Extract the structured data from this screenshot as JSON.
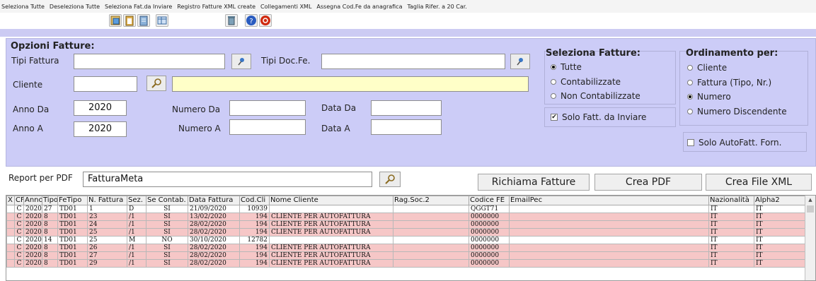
{
  "menu": [
    "Seleziona Tutte",
    "Deseleziona Tutte",
    "Seleziona Fat.da Inviare",
    "Registro Fatture XML create",
    "Collegamenti XML",
    "Assegna Cod.Fe da anagrafica",
    "Taglia Rifer. a 20 Car."
  ],
  "toolbar_icons": [
    "copy-icon",
    "clipboard-icon",
    "report-icon",
    "table-icon",
    "trash-icon",
    "help-icon",
    "stop-icon"
  ],
  "options": {
    "title": "Opzioni Fatture:",
    "tipi_fattura_label": "Tipi Fattura",
    "tipi_fattura_value": "",
    "tipi_docfe_label": "Tipi Doc.Fe.",
    "tipi_docfe_value": "",
    "cliente_label": "Cliente",
    "cliente_code": "",
    "cliente_name": "",
    "anno_da_label": "Anno Da",
    "anno_da_value": "2020",
    "anno_a_label": "Anno A",
    "anno_a_value": "2020",
    "numero_da_label": "Numero Da",
    "numero_da_value": "",
    "numero_a_label": "Numero A",
    "numero_a_value": "",
    "data_da_label": "Data Da",
    "data_da_value": "",
    "data_a_label": "Data A",
    "data_a_value": ""
  },
  "seleziona": {
    "title": "Seleziona Fatture:",
    "options": [
      "Tutte",
      "Contabilizzate",
      "Non Contabilizzate"
    ],
    "selected": 0,
    "solo_inviare": "Solo Fatt. da Inviare",
    "solo_inviare_checked": true
  },
  "ordinamento": {
    "title": "Ordinamento per:",
    "options": [
      "Cliente",
      "Fattura (Tipo, Nr.)",
      "Numero",
      "Numero Discendente"
    ],
    "selected": 2,
    "solo_autofatt": "Solo AutoFatt. Forn.",
    "solo_autofatt_checked": false
  },
  "report": {
    "label": "Report per PDF",
    "value": "FatturaMeta"
  },
  "buttons": {
    "richiama": "Richiama Fatture",
    "crea_pdf": "Crea PDF",
    "crea_xml": "Crea File XML"
  },
  "colors": {
    "panel": "#ccccf7",
    "row_highlight": "#f6c7c7",
    "yellow_field": "#ffffc8"
  },
  "table": {
    "columns": [
      "X",
      "CF",
      "Anno",
      "Tipo",
      "FeTipo",
      "N. Fattura",
      "Sez.",
      "Se Contab.",
      "Data Fattura",
      "Cod.Cli",
      "Nome Cliente",
      "Rag.Soc.2",
      "Codice FE",
      "EmailPec",
      "Nazionalità",
      "Alpha2"
    ],
    "rows": [
      {
        "x": "",
        "cf": "C",
        "anno": "2020",
        "tipo": "27",
        "fetipo": "TD01",
        "nfatt": "1",
        "sez": "D",
        "contab": "SI",
        "data": "21/09/2020",
        "codcli": "10939",
        "nome": "",
        "rag2": "",
        "codfe": "QGGT71",
        "email": "",
        "naz": "IT",
        "alpha2": "IT",
        "hl": false
      },
      {
        "x": "",
        "cf": "C",
        "anno": "2020",
        "tipo": "8",
        "fetipo": "TD01",
        "nfatt": "23",
        "sez": "/1",
        "contab": "SI",
        "data": "13/02/2020",
        "codcli": "194",
        "nome": "CLIENTE PER AUTOFATTURA",
        "rag2": "",
        "codfe": "0000000",
        "email": "",
        "naz": "IT",
        "alpha2": "IT",
        "hl": true
      },
      {
        "x": "",
        "cf": "C",
        "anno": "2020",
        "tipo": "8",
        "fetipo": "TD01",
        "nfatt": "24",
        "sez": "/1",
        "contab": "SI",
        "data": "28/02/2020",
        "codcli": "194",
        "nome": "CLIENTE PER AUTOFATTURA",
        "rag2": "",
        "codfe": "0000000",
        "email": "",
        "naz": "IT",
        "alpha2": "IT",
        "hl": true
      },
      {
        "x": "",
        "cf": "C",
        "anno": "2020",
        "tipo": "8",
        "fetipo": "TD01",
        "nfatt": "25",
        "sez": "/1",
        "contab": "SI",
        "data": "28/02/2020",
        "codcli": "194",
        "nome": "CLIENTE PER AUTOFATTURA",
        "rag2": "",
        "codfe": "0000000",
        "email": "",
        "naz": "IT",
        "alpha2": "IT",
        "hl": true
      },
      {
        "x": "",
        "cf": "C",
        "anno": "2020",
        "tipo": "14",
        "fetipo": "TD01",
        "nfatt": "25",
        "sez": "M",
        "contab": "NO",
        "data": "30/10/2020",
        "codcli": "12782",
        "nome": "",
        "rag2": "",
        "codfe": "0000000",
        "email": "",
        "naz": "IT",
        "alpha2": "IT",
        "hl": false
      },
      {
        "x": "",
        "cf": "C",
        "anno": "2020",
        "tipo": "8",
        "fetipo": "TD01",
        "nfatt": "26",
        "sez": "/1",
        "contab": "SI",
        "data": "28/02/2020",
        "codcli": "194",
        "nome": "CLIENTE PER AUTOFATTURA",
        "rag2": "",
        "codfe": "0000000",
        "email": "",
        "naz": "IT",
        "alpha2": "IT",
        "hl": true
      },
      {
        "x": "",
        "cf": "C",
        "anno": "2020",
        "tipo": "8",
        "fetipo": "TD01",
        "nfatt": "27",
        "sez": "/1",
        "contab": "SI",
        "data": "28/02/2020",
        "codcli": "194",
        "nome": "CLIENTE PER AUTOFATTURA",
        "rag2": "",
        "codfe": "0000000",
        "email": "",
        "naz": "IT",
        "alpha2": "IT",
        "hl": true
      },
      {
        "x": "",
        "cf": "C",
        "anno": "2020",
        "tipo": "8",
        "fetipo": "TD01",
        "nfatt": "29",
        "sez": "/1",
        "contab": "SI",
        "data": "28/02/2020",
        "codcli": "194",
        "nome": "CLIENTE PER AUTOFATTURA",
        "rag2": "",
        "codfe": "0000000",
        "email": "",
        "naz": "IT",
        "alpha2": "IT",
        "hl": true
      }
    ]
  }
}
